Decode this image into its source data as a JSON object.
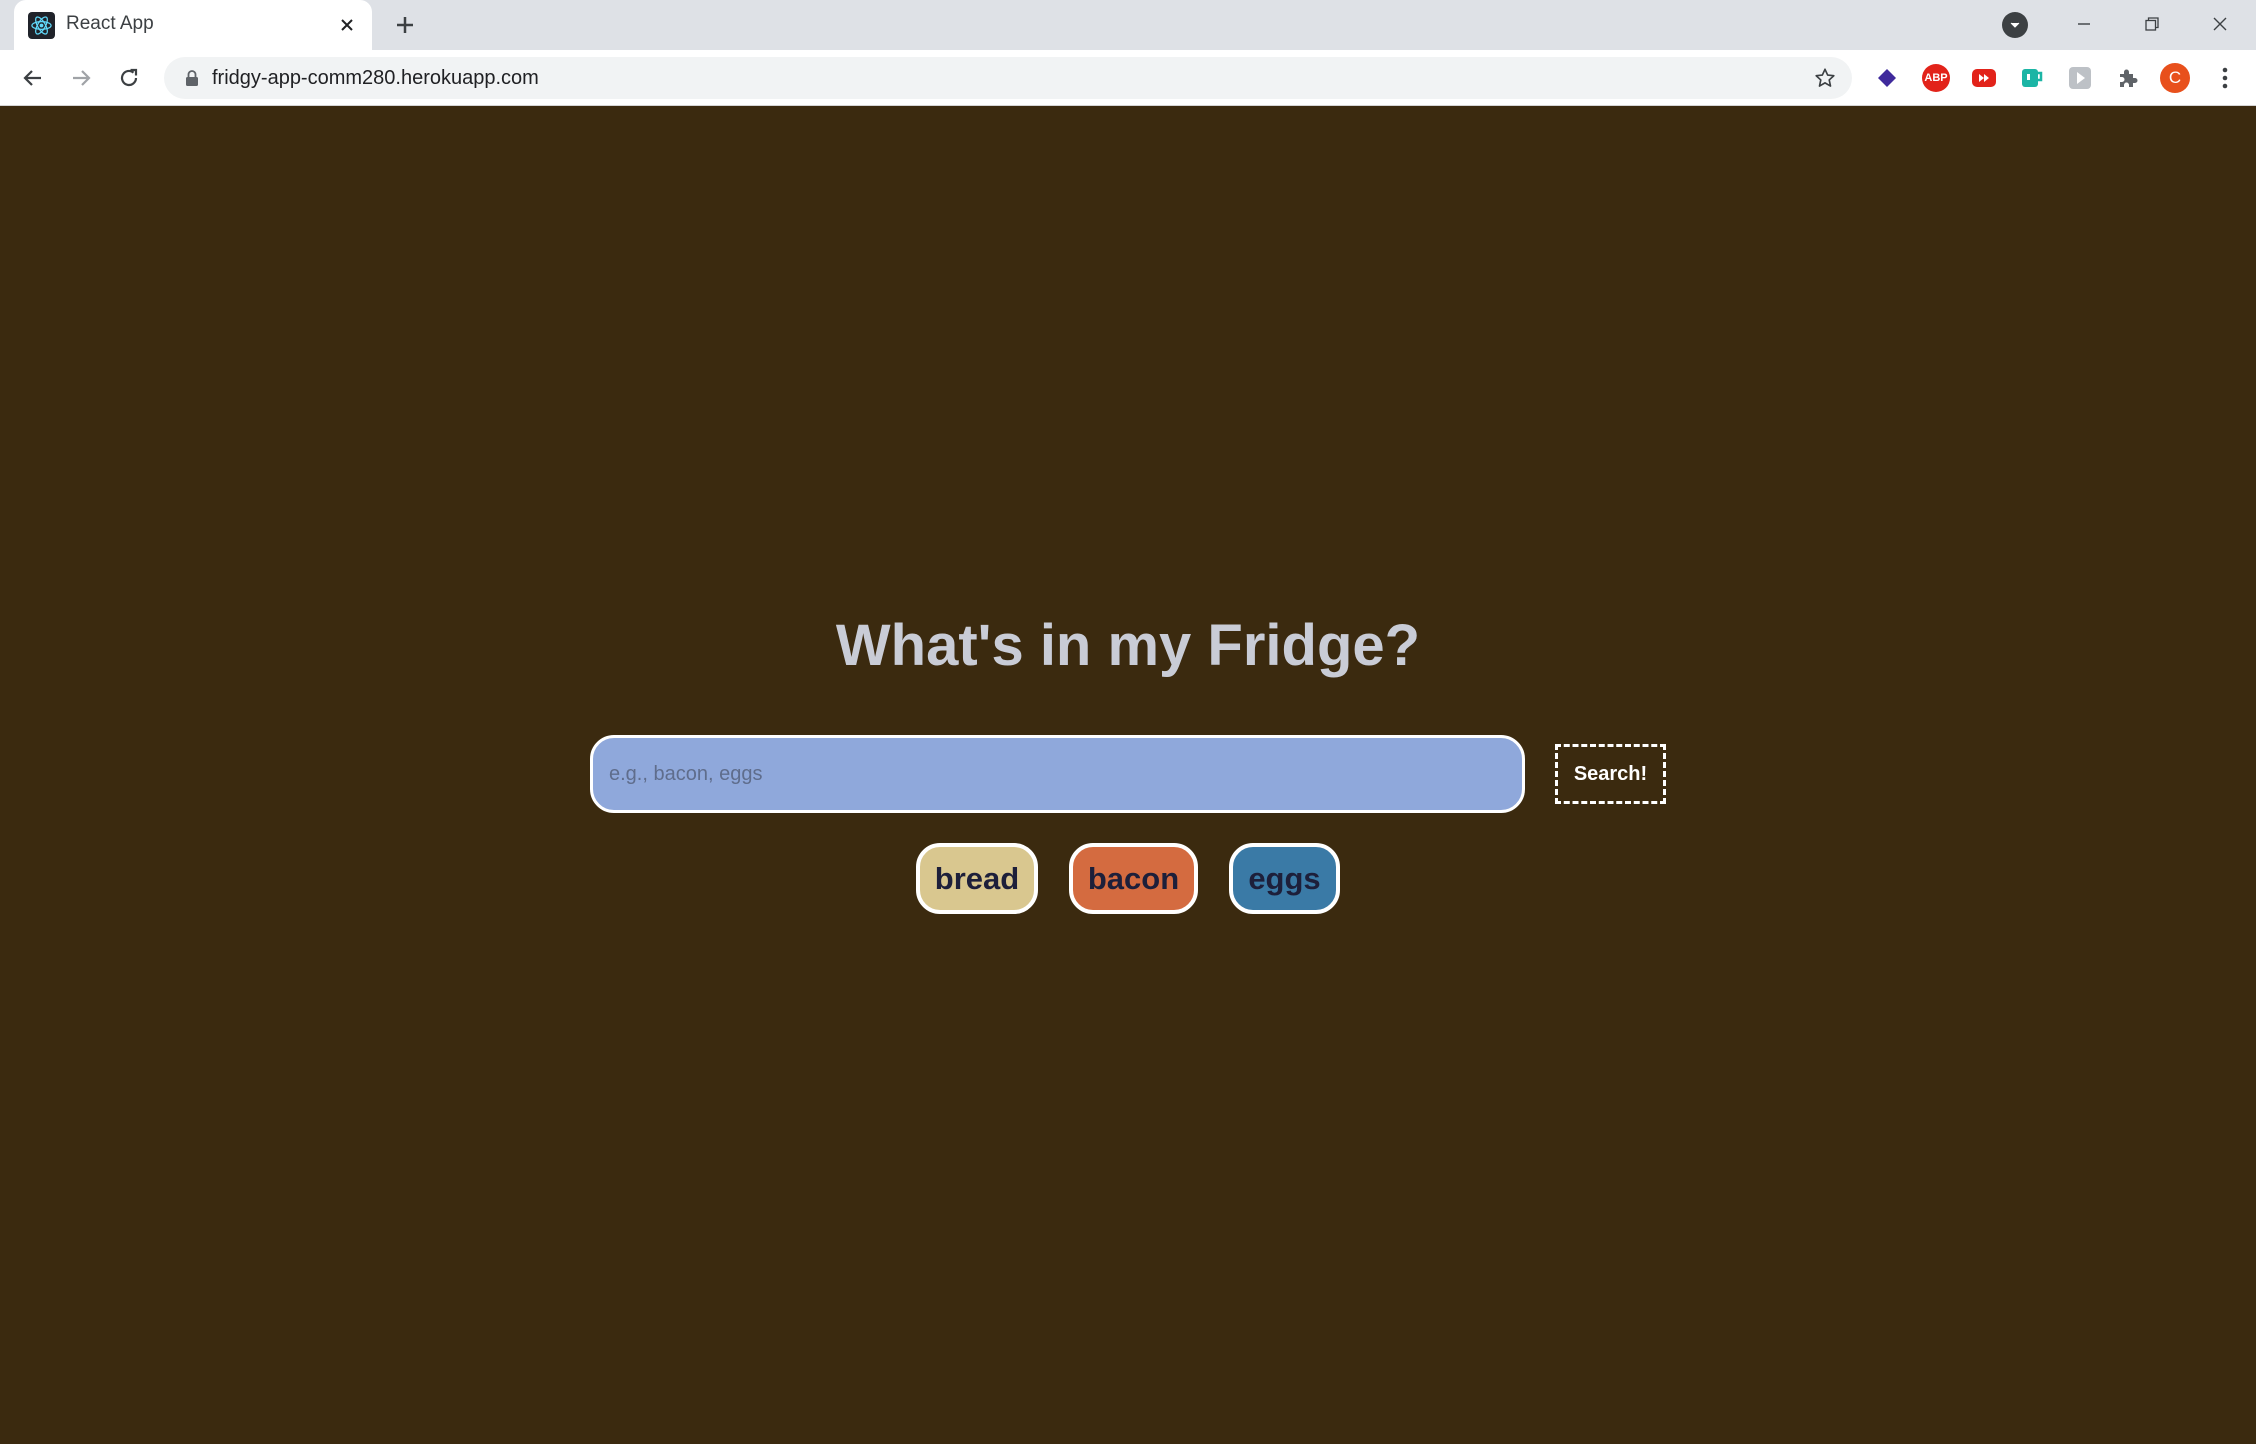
{
  "browser": {
    "tab_title": "React App",
    "url": "fridgy-app-comm280.herokuapp.com",
    "profile_initial": "C",
    "extensions": [
      {
        "name": "layers-extension-icon",
        "color": "#3f2a9c",
        "label": ""
      },
      {
        "name": "adblock-plus-icon",
        "color": "#e2231a",
        "label": "ABP"
      },
      {
        "name": "youtube-extension-icon",
        "color": "#e2231a",
        "label": ""
      },
      {
        "name": "teal-cup-extension-icon",
        "color": "#1bb5a5",
        "label": ""
      },
      {
        "name": "play-extension-icon",
        "color": "#9aa0a6",
        "label": ""
      },
      {
        "name": "puzzle-extensions-icon",
        "color": "#5f6368",
        "label": ""
      }
    ]
  },
  "app": {
    "title": "What's in my Fridge?",
    "search": {
      "placeholder": "e.g., bacon, eggs",
      "value": "",
      "button_label": "Search!"
    },
    "chips": [
      {
        "label": "bread",
        "color": "#d9c78f"
      },
      {
        "label": "bacon",
        "color": "#d46b40"
      },
      {
        "label": "eggs",
        "color": "#3a7aa6"
      }
    ]
  }
}
